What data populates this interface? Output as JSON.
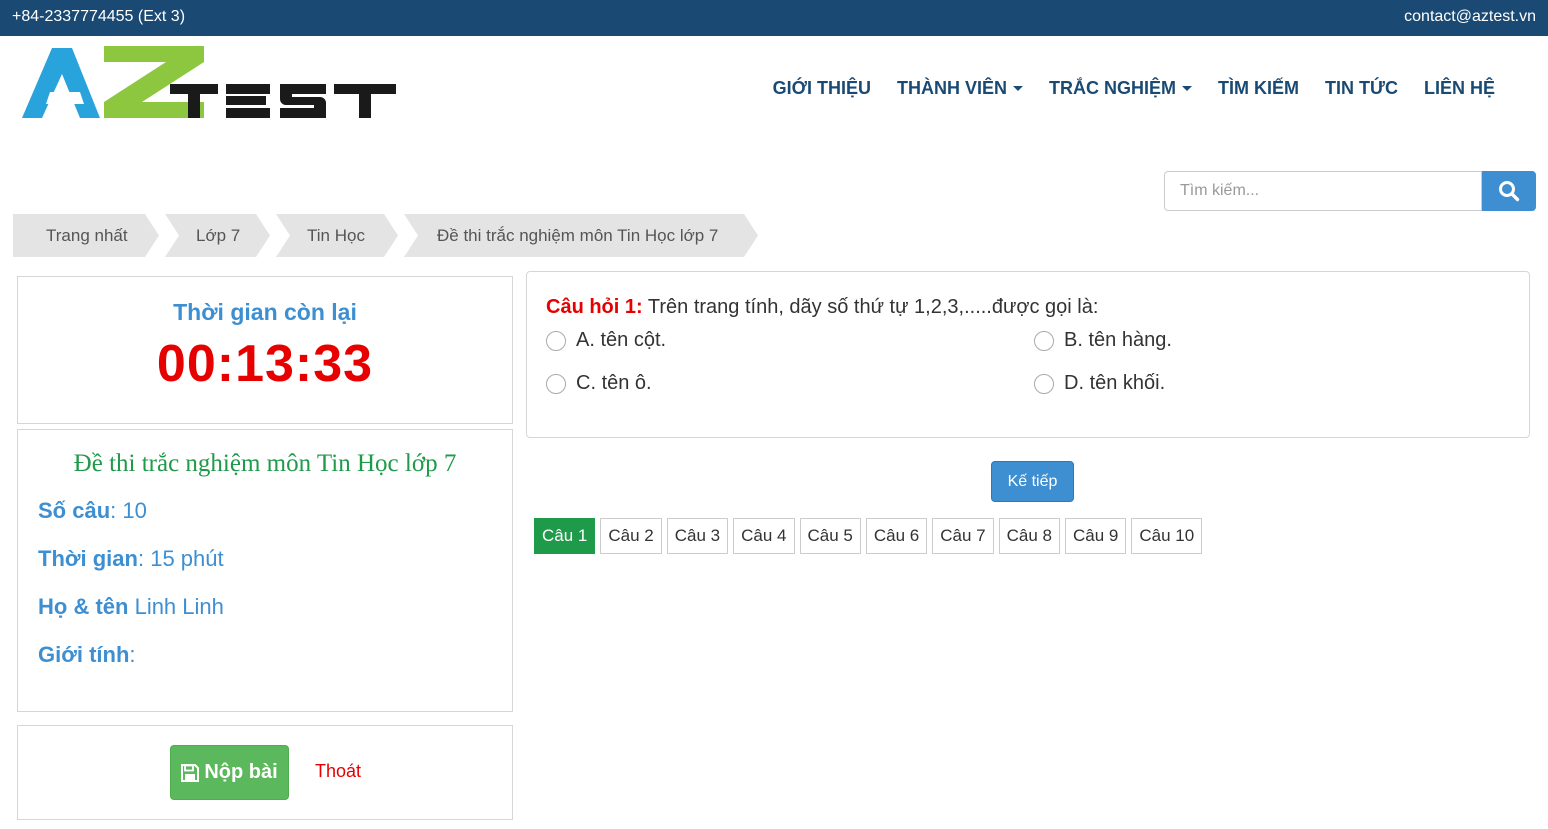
{
  "topbar": {
    "phone": "+84-2337774455  (Ext 3)",
    "email": "contact@aztest.vn"
  },
  "logo": {
    "text": "AZTEST",
    "colors": {
      "a": "#29a3dc",
      "z": "#8dc63f",
      "test": "#1a1a1a"
    }
  },
  "nav": {
    "items": [
      {
        "label": "GIỚI THIỆU",
        "dropdown": false
      },
      {
        "label": "THÀNH VIÊN",
        "dropdown": true
      },
      {
        "label": "TRẮC NGHIỆM",
        "dropdown": true
      },
      {
        "label": "TÌM KIẾM",
        "dropdown": false
      },
      {
        "label": "TIN TỨC",
        "dropdown": false
      },
      {
        "label": "LIÊN HỆ",
        "dropdown": false
      }
    ]
  },
  "search": {
    "placeholder": "Tìm kiếm...",
    "icon": "search-icon"
  },
  "breadcrumb": [
    "Trang nhất",
    "Lớp 7",
    "Tin Học",
    "Đề thi trắc nghiệm môn Tin Học lớp 7"
  ],
  "timer": {
    "title": "Thời gian còn lại",
    "value": "00:13:33"
  },
  "info": {
    "title": "Đề thi trắc nghiệm môn Tin Học lớp 7",
    "rows": [
      {
        "label": "Số câu",
        "sep": ": ",
        "value": "10"
      },
      {
        "label": "Thời gian",
        "sep": ": ",
        "value": "15 phút"
      },
      {
        "label": "Họ & tên",
        "sep": " ",
        "value": "Linh Linh"
      },
      {
        "label": "Giới tính",
        "sep": ":",
        "value": ""
      }
    ]
  },
  "actions": {
    "submit": "Nộp bài",
    "exit": "Thoát"
  },
  "question": {
    "label": "Câu hỏi 1:",
    "text": "Trên trang tính, dãy số thứ tự 1,2,3,.....được gọi là:",
    "options": [
      {
        "key": "A.",
        "text": "tên cột."
      },
      {
        "key": "B.",
        "text": "tên hàng."
      },
      {
        "key": "C.",
        "text": "tên ô."
      },
      {
        "key": "D.",
        "text": "tên khối."
      }
    ]
  },
  "next": "Kế tiếp",
  "pager": [
    "Câu 1",
    "Câu 2",
    "Câu 3",
    "Câu 4",
    "Câu 5",
    "Câu 6",
    "Câu 7",
    "Câu 8",
    "Câu 9",
    "Câu 10"
  ],
  "pager_active": 1,
  "colors": {
    "brand": "#1a4a73",
    "accent": "#3d8fd1",
    "danger": "#e60000",
    "success": "#1f9a4a"
  }
}
